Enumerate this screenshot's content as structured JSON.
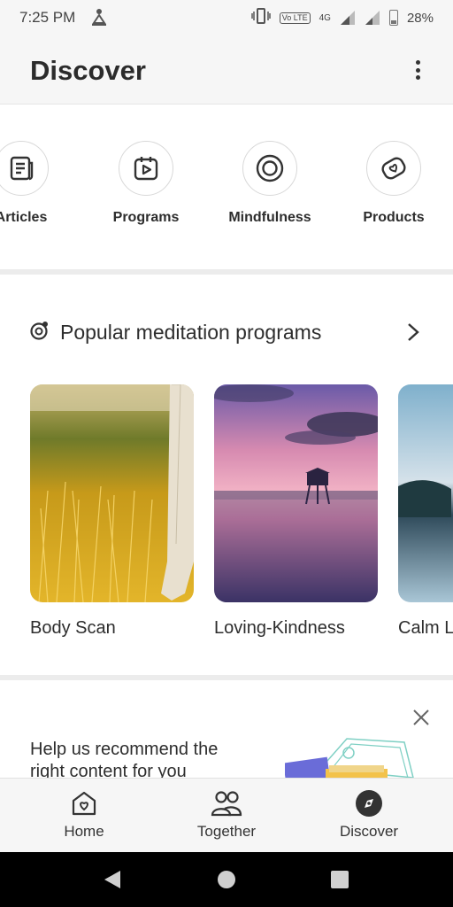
{
  "status_bar": {
    "time": "7:25 PM",
    "network": "4G",
    "volte": "Vo LTE",
    "battery": "28%"
  },
  "header": {
    "title": "Discover",
    "menu_icon": "more-vertical-icon"
  },
  "categories": [
    {
      "label": "Articles",
      "icon": "article-icon"
    },
    {
      "label": "Programs",
      "icon": "program-play-icon"
    },
    {
      "label": "Mindfulness",
      "icon": "mindfulness-icon"
    },
    {
      "label": "Products",
      "icon": "products-icon"
    }
  ],
  "popular": {
    "title": "Popular meditation programs",
    "icon": "meditation-icon",
    "cards": [
      {
        "name": "Body Scan"
      },
      {
        "name": "Loving-Kindness"
      },
      {
        "name": "Calm L"
      }
    ]
  },
  "recommend": {
    "line1": "Help us recommend the",
    "line2": "right content for you"
  },
  "bottom_nav": [
    {
      "label": "Home",
      "icon": "home-heart-icon"
    },
    {
      "label": "Together",
      "icon": "people-icon"
    },
    {
      "label": "Discover",
      "icon": "compass-icon",
      "active": true
    }
  ],
  "colors": {
    "background": "#f6f6f6",
    "text": "#2d2d2d",
    "nav_active": "#333333"
  }
}
